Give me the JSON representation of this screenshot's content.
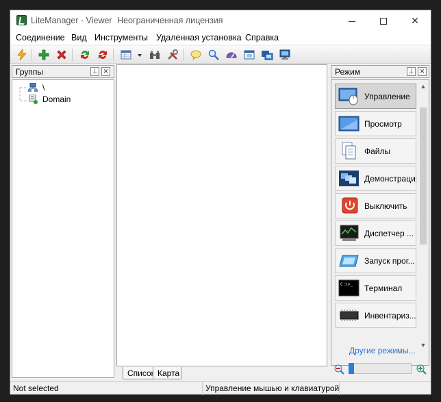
{
  "window": {
    "app_title": "LiteManager - Viewer",
    "license": "Неограниченная лицензия"
  },
  "menu": {
    "items": [
      "Соединение",
      "Вид",
      "Инструменты",
      "Удаленная установка",
      "Справка"
    ]
  },
  "toolbar": {
    "icons": [
      "connect-icon",
      "add-icon",
      "delete-icon",
      "refresh-icon",
      "refresh-all-icon",
      "view-mode-icon",
      "dropdown-icon",
      "network-icon",
      "tools-icon",
      "chat-icon",
      "search-icon",
      "speed-icon",
      "window-icon",
      "screens-icon",
      "monitor-icon"
    ]
  },
  "groups_panel": {
    "title": "Группы",
    "tree": [
      {
        "label": "\\",
        "icon": "network-root-icon"
      },
      {
        "label": "Domain",
        "icon": "domain-icon"
      }
    ]
  },
  "center": {
    "tabs": [
      "Список",
      "Карта"
    ]
  },
  "mode_panel": {
    "title": "Режим",
    "modes": [
      {
        "label": "Управление",
        "icon": "mouse-control-icon",
        "active": true
      },
      {
        "label": "Просмотр",
        "icon": "view-screen-icon",
        "active": false
      },
      {
        "label": "Файлы",
        "icon": "files-icon",
        "active": false
      },
      {
        "label": "Демонстрация",
        "icon": "demo-icon",
        "active": false
      },
      {
        "label": "Выключить",
        "icon": "power-icon",
        "active": false
      },
      {
        "label": "Диспетчер ...",
        "icon": "task-manager-icon",
        "active": false
      },
      {
        "label": "Запуск прог...",
        "icon": "run-program-icon",
        "active": false
      },
      {
        "label": "Терминал",
        "icon": "terminal-icon",
        "active": false
      },
      {
        "label": "Инвентариз...",
        "icon": "inventory-chip-icon",
        "active": false
      }
    ],
    "other_modes_link": "Другие режимы..."
  },
  "status": {
    "left": "Not selected",
    "right": "Управление мышью и клавиатурой"
  },
  "colors": {
    "accent": "#2a7fd4",
    "link": "#2a6fcf",
    "delete_red": "#d32f2f",
    "add_green": "#2e9e3a"
  }
}
